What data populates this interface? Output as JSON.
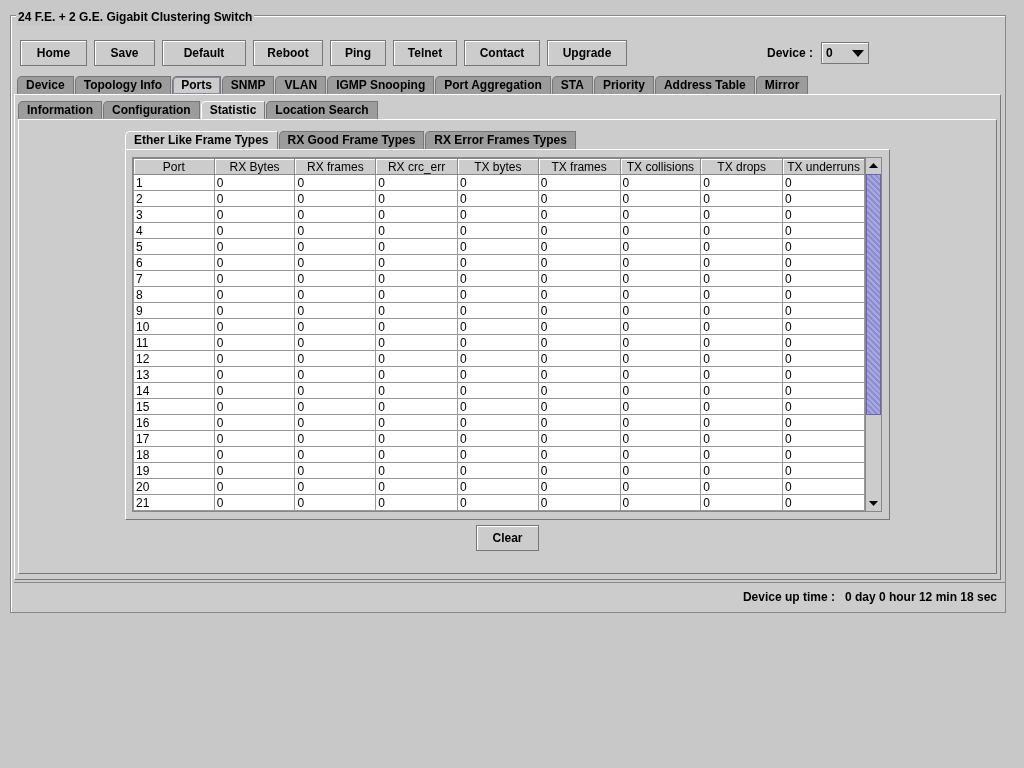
{
  "window": {
    "title": "24 F.E. + 2 G.E. Gigabit Clustering Switch"
  },
  "toolbar": [
    "Home",
    "Save",
    "Default",
    "Reboot",
    "Ping",
    "Telnet",
    "Contact",
    "Upgrade"
  ],
  "device": {
    "label": "Device :",
    "value": "0"
  },
  "tabs": [
    {
      "label": "Device",
      "selected": false
    },
    {
      "label": "Topology Info",
      "selected": false
    },
    {
      "label": "Ports",
      "selected": true
    },
    {
      "label": "SNMP",
      "selected": false
    },
    {
      "label": "VLAN",
      "selected": false
    },
    {
      "label": "IGMP Snooping",
      "selected": false
    },
    {
      "label": "Port Aggregation",
      "selected": false
    },
    {
      "label": "STA",
      "selected": false
    },
    {
      "label": "Priority",
      "selected": false
    },
    {
      "label": "Address Table",
      "selected": false
    },
    {
      "label": "Mirror",
      "selected": false
    }
  ],
  "subtabs": [
    {
      "label": "Information",
      "selected": false
    },
    {
      "label": "Configuration",
      "selected": false
    },
    {
      "label": "Statistic",
      "selected": true
    },
    {
      "label": "Location Search",
      "selected": false
    }
  ],
  "frame_tabs": [
    {
      "label": "Ether Like Frame Types",
      "selected": true
    },
    {
      "label": "RX Good Frame Types",
      "selected": false
    },
    {
      "label": "RX Error Frames Types",
      "selected": false
    }
  ],
  "table": {
    "columns": [
      "Port",
      "RX Bytes",
      "RX frames",
      "RX crc_err",
      "TX bytes",
      "TX frames",
      "TX collisions",
      "TX drops",
      "TX underruns"
    ],
    "rows": [
      [
        "1",
        "0",
        "0",
        "0",
        "0",
        "0",
        "0",
        "0",
        "0"
      ],
      [
        "2",
        "0",
        "0",
        "0",
        "0",
        "0",
        "0",
        "0",
        "0"
      ],
      [
        "3",
        "0",
        "0",
        "0",
        "0",
        "0",
        "0",
        "0",
        "0"
      ],
      [
        "4",
        "0",
        "0",
        "0",
        "0",
        "0",
        "0",
        "0",
        "0"
      ],
      [
        "5",
        "0",
        "0",
        "0",
        "0",
        "0",
        "0",
        "0",
        "0"
      ],
      [
        "6",
        "0",
        "0",
        "0",
        "0",
        "0",
        "0",
        "0",
        "0"
      ],
      [
        "7",
        "0",
        "0",
        "0",
        "0",
        "0",
        "0",
        "0",
        "0"
      ],
      [
        "8",
        "0",
        "0",
        "0",
        "0",
        "0",
        "0",
        "0",
        "0"
      ],
      [
        "9",
        "0",
        "0",
        "0",
        "0",
        "0",
        "0",
        "0",
        "0"
      ],
      [
        "10",
        "0",
        "0",
        "0",
        "0",
        "0",
        "0",
        "0",
        "0"
      ],
      [
        "11",
        "0",
        "0",
        "0",
        "0",
        "0",
        "0",
        "0",
        "0"
      ],
      [
        "12",
        "0",
        "0",
        "0",
        "0",
        "0",
        "0",
        "0",
        "0"
      ],
      [
        "13",
        "0",
        "0",
        "0",
        "0",
        "0",
        "0",
        "0",
        "0"
      ],
      [
        "14",
        "0",
        "0",
        "0",
        "0",
        "0",
        "0",
        "0",
        "0"
      ],
      [
        "15",
        "0",
        "0",
        "0",
        "0",
        "0",
        "0",
        "0",
        "0"
      ],
      [
        "16",
        "0",
        "0",
        "0",
        "0",
        "0",
        "0",
        "0",
        "0"
      ],
      [
        "17",
        "0",
        "0",
        "0",
        "0",
        "0",
        "0",
        "0",
        "0"
      ],
      [
        "18",
        "0",
        "0",
        "0",
        "0",
        "0",
        "0",
        "0",
        "0"
      ],
      [
        "19",
        "0",
        "0",
        "0",
        "0",
        "0",
        "0",
        "0",
        "0"
      ],
      [
        "20",
        "0",
        "0",
        "0",
        "0",
        "0",
        "0",
        "0",
        "0"
      ],
      [
        "21",
        "0",
        "0",
        "0",
        "0",
        "0",
        "0",
        "0",
        "0"
      ]
    ]
  },
  "clear_button": "Clear",
  "status_bar": {
    "label": "Device up time :",
    "value": "0 day 0 hour 12 min 18 sec"
  }
}
